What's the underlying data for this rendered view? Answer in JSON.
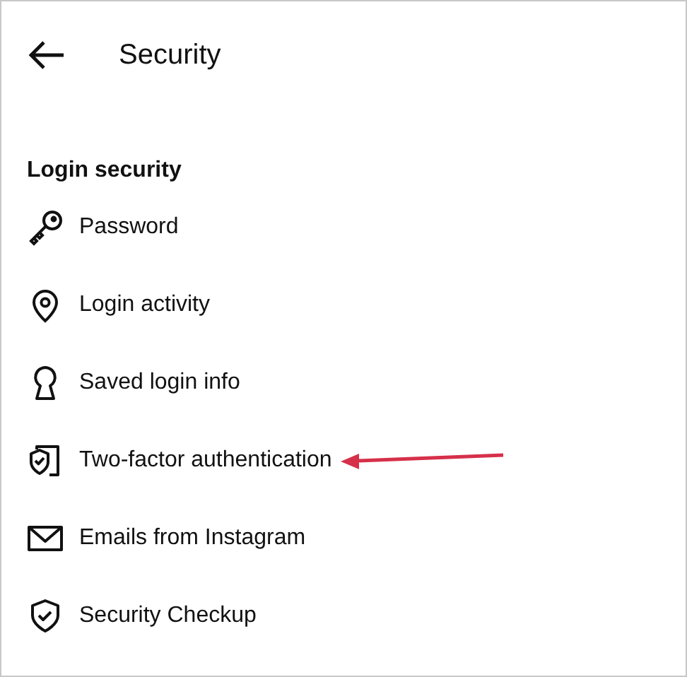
{
  "header": {
    "title": "Security"
  },
  "section": {
    "title": "Login security"
  },
  "items": [
    {
      "label": "Password",
      "kind": "key",
      "highlighted": false
    },
    {
      "label": "Login activity",
      "kind": "pin",
      "highlighted": false
    },
    {
      "label": "Saved login info",
      "kind": "keyhole",
      "highlighted": false
    },
    {
      "label": "Two-factor authentication",
      "kind": "shield-device",
      "highlighted": true
    },
    {
      "label": "Emails from Instagram",
      "kind": "mail",
      "highlighted": false
    },
    {
      "label": "Security Checkup",
      "kind": "shield",
      "highlighted": false
    }
  ]
}
